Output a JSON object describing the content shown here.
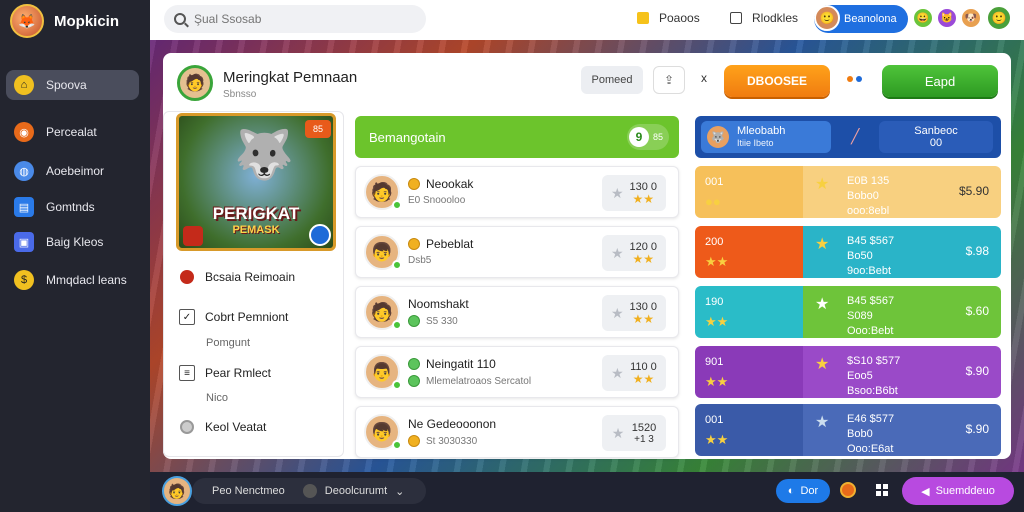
{
  "app": {
    "name": "Mopkicin"
  },
  "sidebar": {
    "items": [
      {
        "label": "Spoova",
        "icon": "home-icon",
        "color": "#f0c020"
      },
      {
        "label": "Percealat",
        "icon": "controller-icon",
        "color": "#e86a1a"
      },
      {
        "label": "Aoebeimor",
        "icon": "globe-icon",
        "color": "#4a8ae8"
      },
      {
        "label": "Gomtnds",
        "icon": "chat-icon",
        "color": "#2a7ae8"
      },
      {
        "label": "Baig Kleos",
        "icon": "image-icon",
        "color": "#4a6ae8"
      },
      {
        "label": "Mmqdacl leans",
        "icon": "coin-icon",
        "color": "#f0c020"
      }
    ]
  },
  "topbar": {
    "search_placeholder": "Şual Ssosab",
    "link1": "Poaoos",
    "link2": "Rlodkles",
    "user_label": "Beanolona"
  },
  "header": {
    "title": "Meringkat Pemnaan",
    "subtitle": "Sbnsso",
    "btn_grey": "Pomeed",
    "btn_x": "x",
    "btn_orange": "DBOOSEE",
    "btn_green": "Eapd"
  },
  "game": {
    "title": "PERIGKAT",
    "subtitle": "PEMASK",
    "badge": "85"
  },
  "left_list": [
    {
      "label": "Bcsaia Reimoain",
      "icon": "record-icon"
    },
    {
      "label": "Cobrt Pemniont",
      "icon": "checkbox-icon",
      "sub": "Pomgunt"
    },
    {
      "label": "Pear Rmlect",
      "icon": "list-icon",
      "sub": "Nico"
    },
    {
      "label": "Keol Veatat",
      "icon": "toggle-icon"
    }
  ],
  "middle": {
    "title": "Bemangotain",
    "badge_num": "9",
    "badge_txt": "85",
    "players": [
      {
        "name": "Neookak",
        "sub": "E0 Snoooloo",
        "score": "130 0",
        "tag": "coin"
      },
      {
        "name": "Pebeblat",
        "sub": "Dsb5",
        "score": "120 0",
        "tag": "coin"
      },
      {
        "name": "Noomshakt",
        "sub": "S5 330",
        "score": "130 0",
        "tag": "coin"
      },
      {
        "name": "Neingatit 110",
        "sub": "Mlemelatroaos Sercatol",
        "score": "110 0",
        "tag": "green"
      },
      {
        "name": "Ne Gedeooonon",
        "sub": "St 3030330",
        "score": "1520",
        "score2": "+1 3",
        "tag": "coin"
      }
    ]
  },
  "right": {
    "head_name": "Mleobabh",
    "head_sub": "Itiie Ibeto",
    "head_right": "Sanbeoc",
    "head_right_sub": "00",
    "cards": [
      {
        "val": "001",
        "mid1": "E0B 135",
        "mid2": "Bobo0",
        "mid3": "ooo:8ebl",
        "price": "$5.90",
        "left": "#f6c05a",
        "right": "#f8d080"
      },
      {
        "val": "200",
        "mid1": "B45 $567",
        "mid2": "Bo50",
        "mid3": "9oo:Bebt",
        "price": "$.98",
        "left": "#ee5a1a",
        "right": "#2ab4c8"
      },
      {
        "val": "190",
        "mid1": "B45 $567",
        "mid2": "S089",
        "mid3": "Ooo:Bebt",
        "price": "$.60",
        "left": "#2abcc8",
        "right": "#6ec43a"
      },
      {
        "val": "901",
        "mid1": "$S10 $577",
        "mid2": "Eoo5",
        "mid3": "Bsoo:B6bt",
        "price": "$.90",
        "left": "#8a3ab8",
        "right": "#9a4ac8"
      },
      {
        "val": "001",
        "mid1": "E46 $577",
        "mid2": "Bob0",
        "mid3": "Ooo:E6at",
        "price": "$.90",
        "left": "#3a5aa8",
        "right": "#4a6ab8"
      }
    ]
  },
  "bottom": {
    "user": "Peo Nenctmeo",
    "status": "Deoolcurumt",
    "btn_blue": "Dor",
    "btn_purple": "Suemddeuo"
  }
}
